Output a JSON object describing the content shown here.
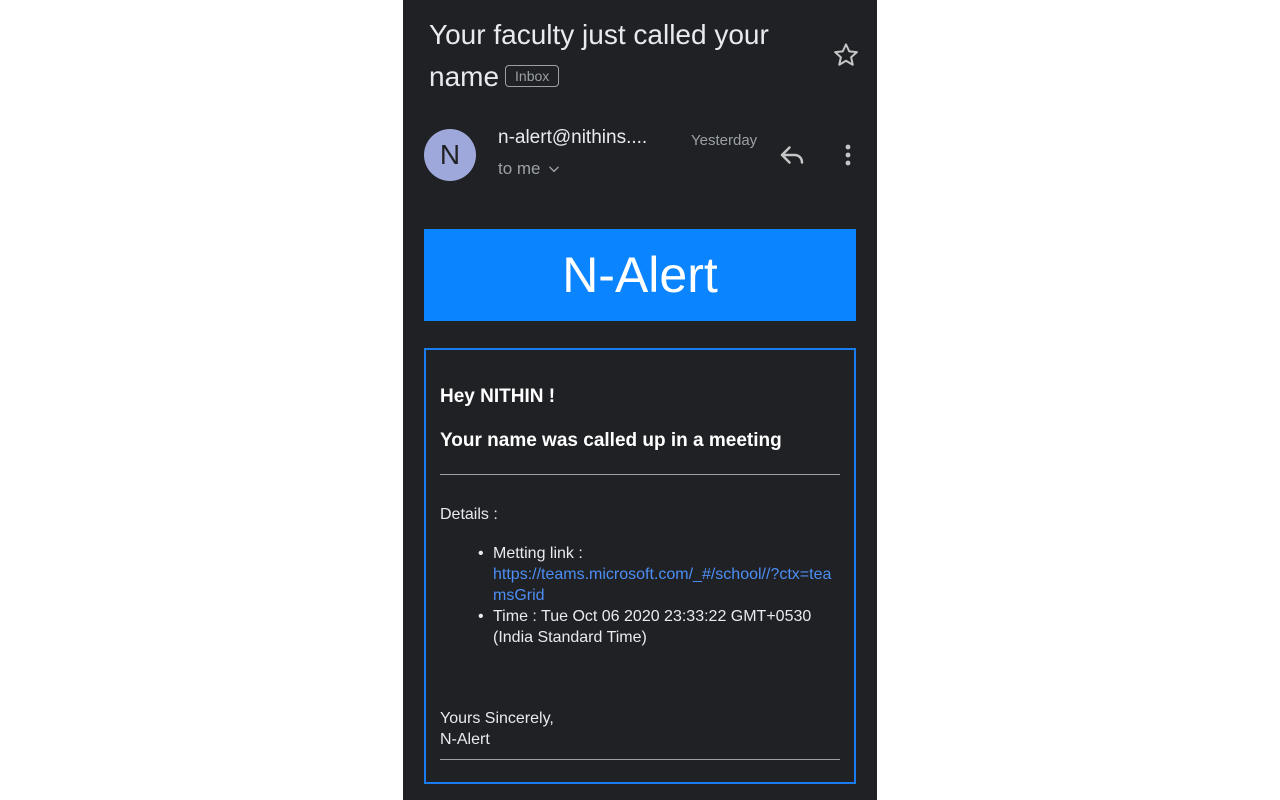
{
  "email": {
    "subject": "Your faculty just called your name",
    "label": "Inbox",
    "sender": {
      "initial": "N",
      "address": "n-alert@nithins....",
      "recipient_line": "to me",
      "date": "Yesterday"
    },
    "banner": "N-Alert",
    "body": {
      "greeting": "Hey NITHIN !",
      "headline": "Your name was called up in a meeting",
      "details_label": "Details :",
      "details": [
        {
          "label": "Metting link :",
          "value": "https://teams.microsoft.com/_#/school//?ctx=teamsGrid"
        },
        {
          "label": "Time :",
          "value": "Tue Oct 06 2020 23:33:22 GMT+0530 (India Standard Time)"
        }
      ],
      "signoff_line1": "Yours Sincerely,",
      "signoff_line2": "N-Alert"
    }
  },
  "icons": {
    "star": "star-icon",
    "reply": "reply-icon",
    "more": "more-vert-icon",
    "expand": "chevron-down-icon"
  },
  "colors": {
    "background": "#202124",
    "banner": "#0a84ff",
    "card_border": "#1a7cf0",
    "link": "#4c8ef5",
    "avatar": "#9fa8da"
  }
}
